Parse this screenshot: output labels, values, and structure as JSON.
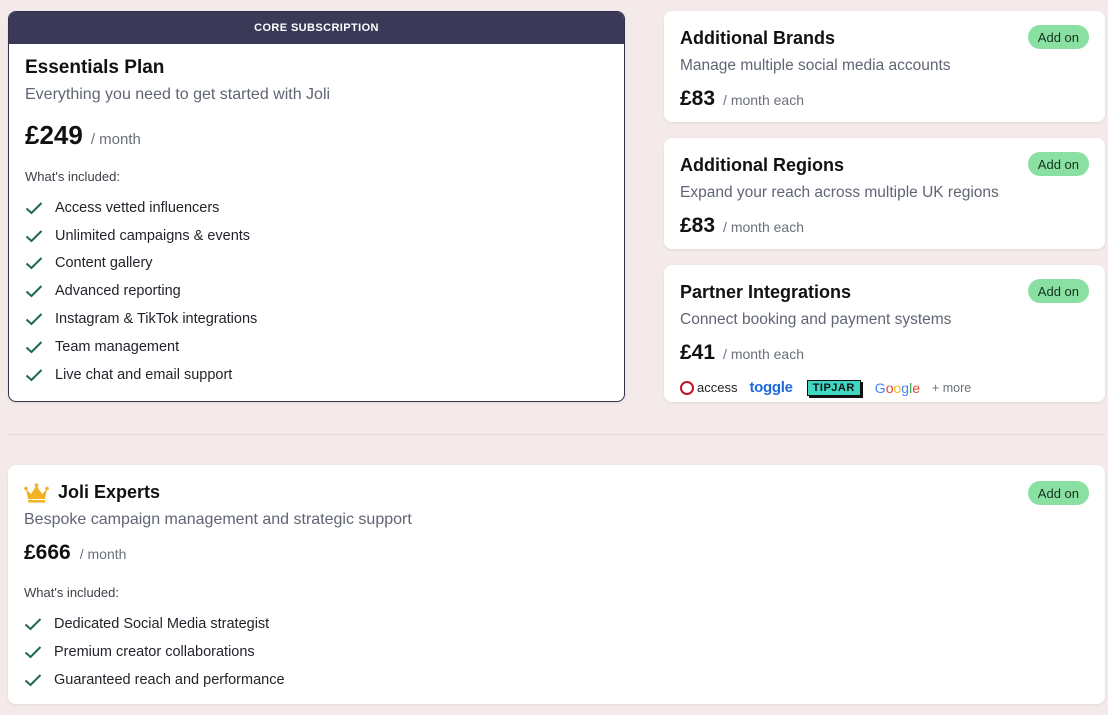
{
  "core": {
    "banner": "CORE SUBSCRIPTION",
    "title": "Essentials Plan",
    "subtitle": "Everything you need to get started with Joli",
    "price": "£249",
    "unit": "/ month",
    "included_label": "What's included:",
    "features": [
      "Access vetted influencers",
      "Unlimited campaigns & events",
      "Content gallery",
      "Advanced reporting",
      "Instagram & TikTok integrations",
      "Team management",
      "Live chat and email support"
    ]
  },
  "addons": [
    {
      "title": "Additional Brands",
      "subtitle": "Manage multiple social media accounts",
      "price": "£83",
      "unit": "/ month each",
      "badge": "Add on"
    },
    {
      "title": "Additional Regions",
      "subtitle": "Expand your reach across multiple UK regions",
      "price": "£83",
      "unit": "/ month each",
      "badge": "Add on"
    },
    {
      "title": "Partner Integrations",
      "subtitle": "Connect booking and payment systems",
      "price": "£41",
      "unit": "/ month each",
      "badge": "Add on",
      "partners": {
        "access": "access",
        "toggle": "toggle",
        "tipjar": "TIPJAR",
        "google": "Google",
        "more": "+ more"
      }
    }
  ],
  "experts": {
    "icon": "crown-icon",
    "title": "Joli Experts",
    "subtitle": "Bespoke campaign management and strategic support",
    "price": "£666",
    "unit": "/ month",
    "badge": "Add on",
    "included_label": "What's included:",
    "features": [
      "Dedicated Social Media strategist",
      "Premium creator collaborations",
      "Guaranteed reach and performance"
    ]
  },
  "colors": {
    "background": "#f4eaea",
    "banner": "#3a3957",
    "badge": "#8ae0a3",
    "check": "#1b6b4a",
    "crown": "#f2b322"
  }
}
